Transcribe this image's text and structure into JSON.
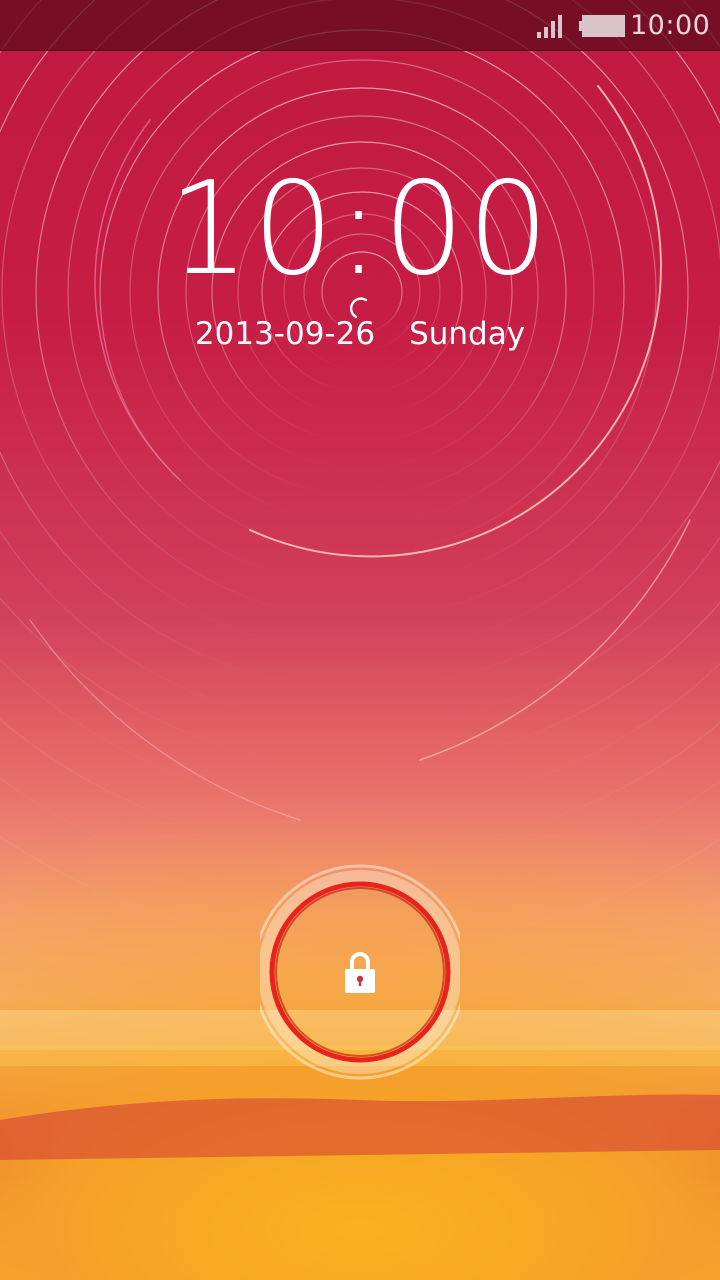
{
  "status_bar": {
    "time": "10:00",
    "signal_icon": "signal-bars-icon",
    "battery_icon": "battery-icon"
  },
  "lockscreen": {
    "time": "10:00",
    "date": "2013-09-26",
    "weekday": "Sunday",
    "unlock_icon": "padlock-icon"
  },
  "colors": {
    "unlock_ring": "#e8231c",
    "status_bar_bg": "#5a0a1e",
    "text": "#ffffff"
  }
}
